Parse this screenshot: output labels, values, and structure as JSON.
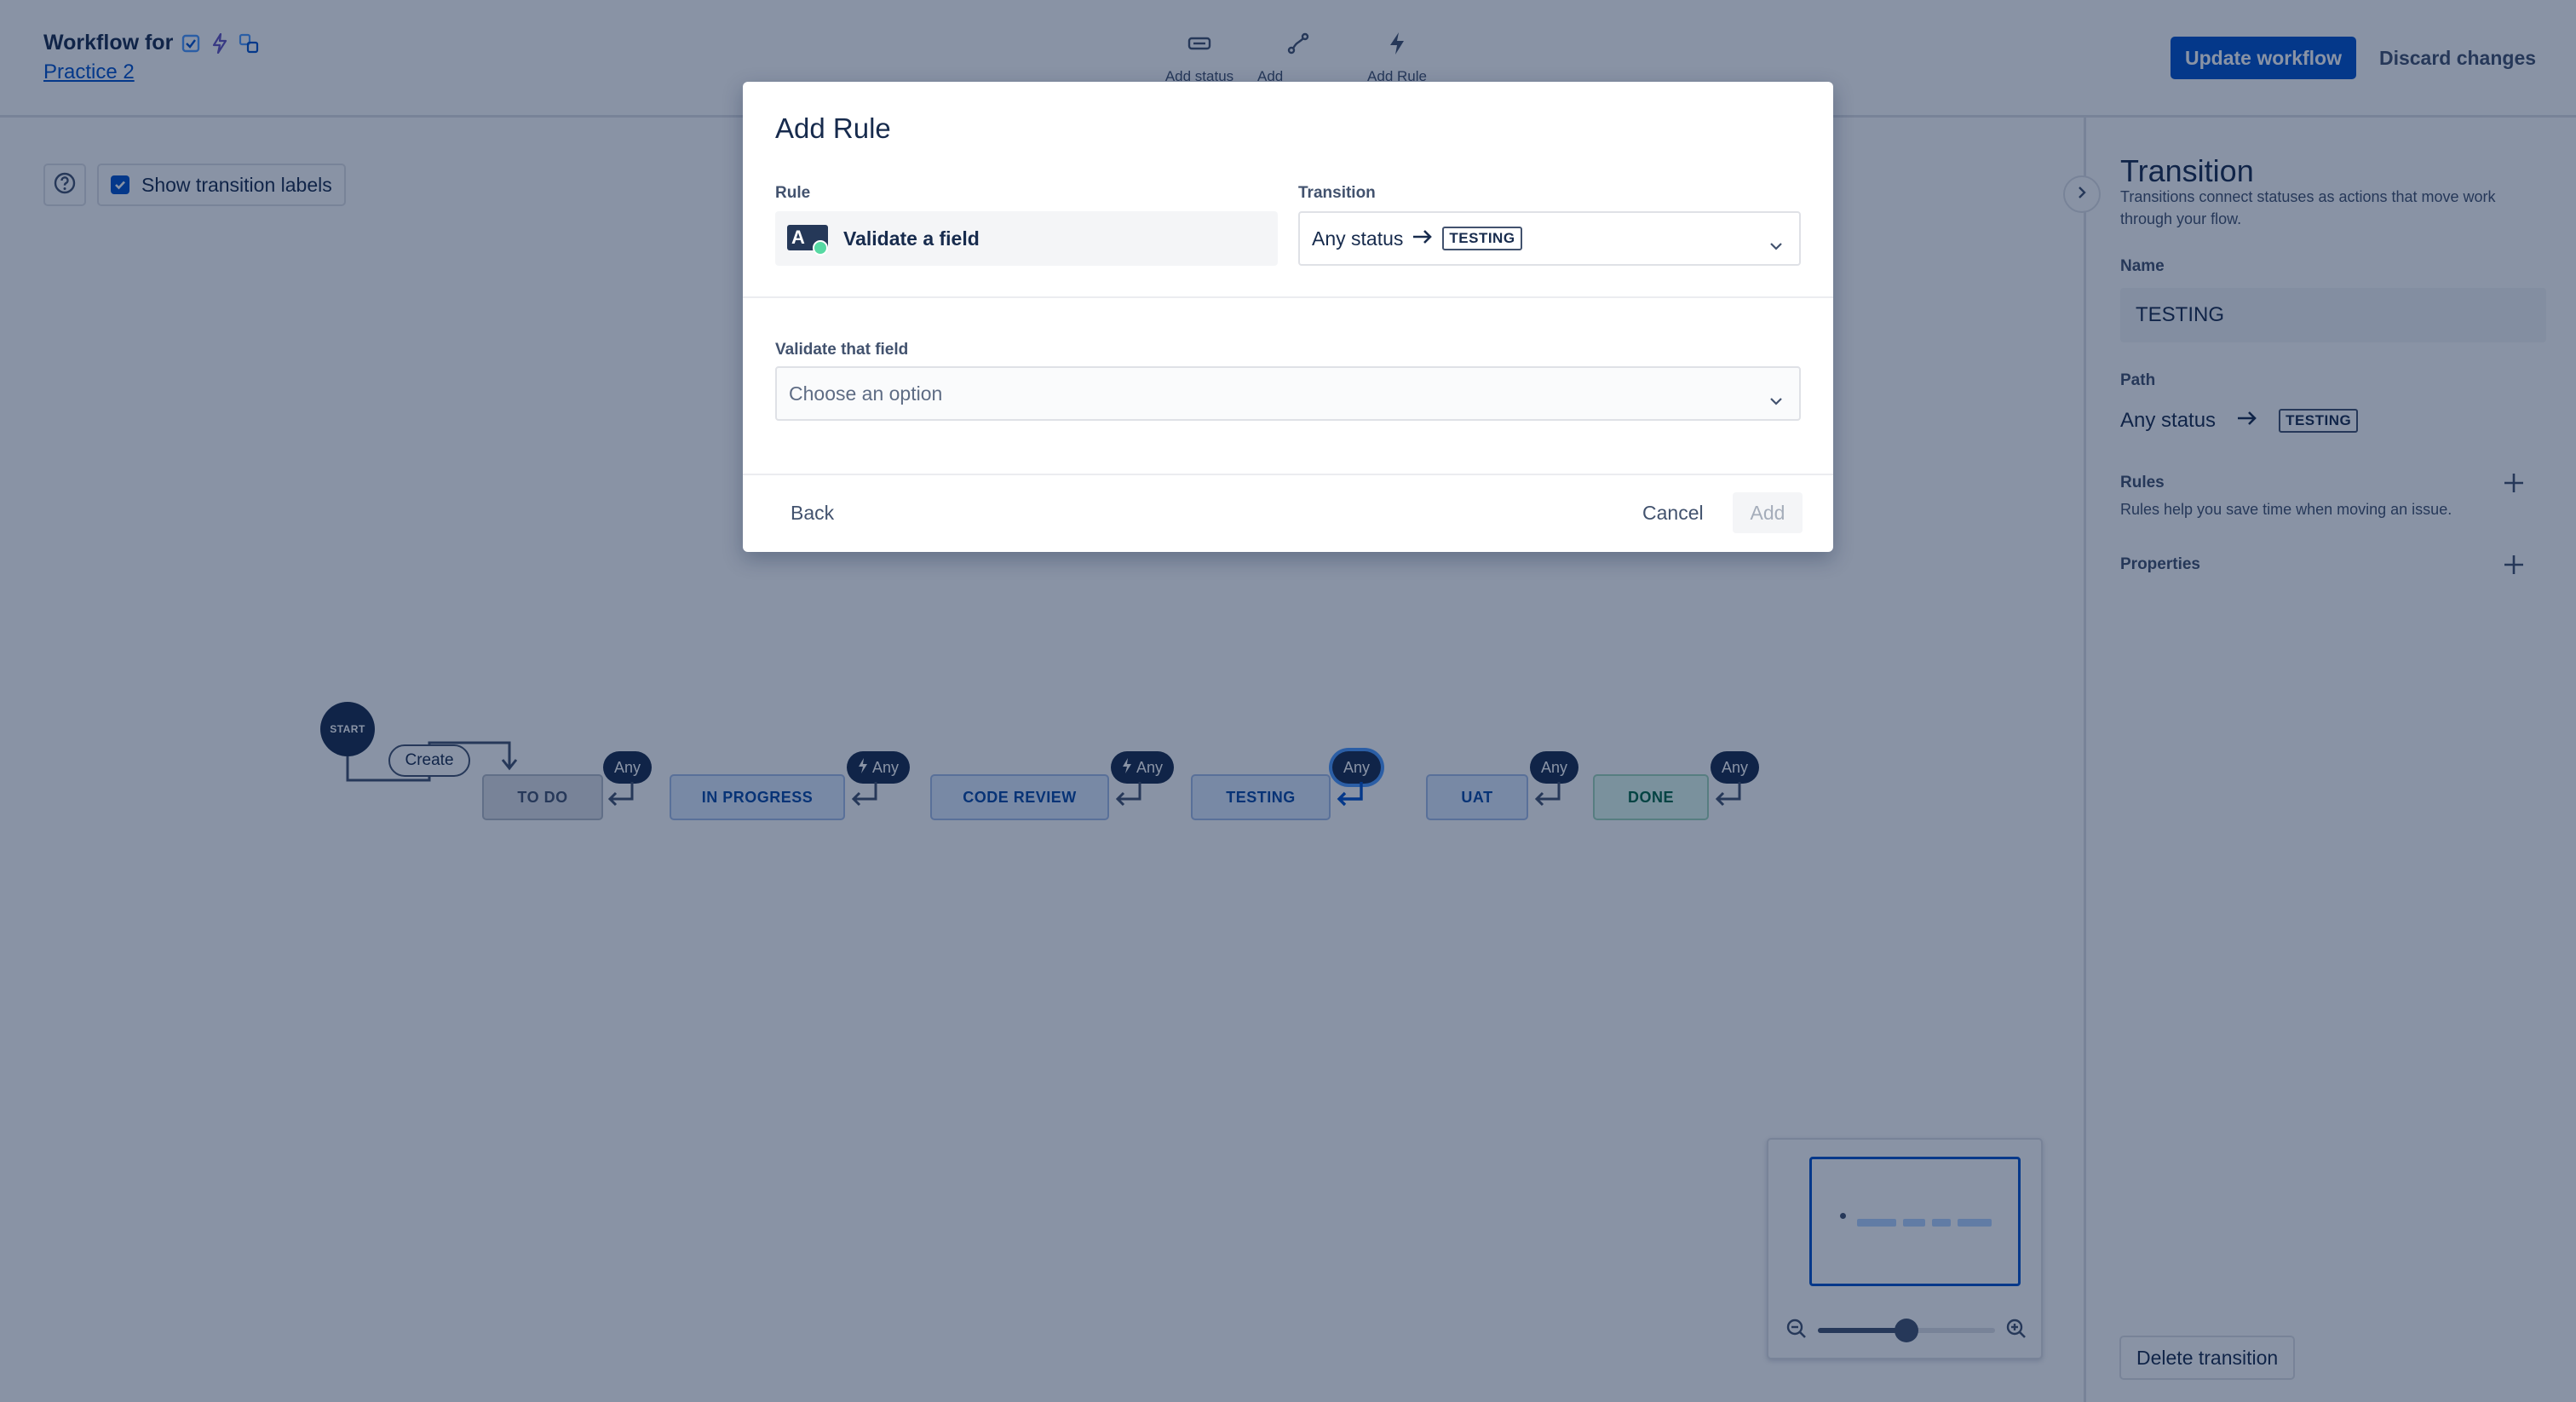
{
  "header": {
    "title_prefix": "Workflow for",
    "project_link": "Practice 2",
    "issue_type_icons": [
      "task-checkbox-icon",
      "epic-lightning-icon",
      "subtask-icon"
    ]
  },
  "toolbar": {
    "items": [
      {
        "label": "Add status",
        "icon": "status-rectangle-icon"
      },
      {
        "label": "Add Transition",
        "icon": "transition-path-icon"
      },
      {
        "label": "Add Rule",
        "icon": "lightning-icon"
      }
    ]
  },
  "actions": {
    "update": "Update workflow",
    "discard": "Discard changes"
  },
  "canvas": {
    "help_icon": "question-circle-icon",
    "show_labels": "Show transition labels",
    "show_labels_checked": true,
    "start": "START",
    "create": "Create",
    "any": "Any",
    "statuses": [
      "TO DO",
      "IN PROGRESS",
      "CODE REVIEW",
      "TESTING",
      "UAT",
      "DONE"
    ]
  },
  "panel": {
    "title": "Transition",
    "subtitle": "Transitions connect statuses as actions that move work through your flow.",
    "name_label": "Name",
    "name_value": "TESTING",
    "path_label": "Path",
    "path_from": "Any status",
    "path_to": "TESTING",
    "rules_label": "Rules",
    "rules_help": "Rules help you save time when moving an issue.",
    "properties_label": "Properties",
    "delete": "Delete transition"
  },
  "modal": {
    "title": "Add Rule",
    "rule_label": "Rule",
    "rule_value": "Validate a field",
    "rule_icon_letter": "A",
    "transition_label": "Transition",
    "transition_from": "Any status",
    "transition_to": "TESTING",
    "field_label": "Validate that field",
    "field_placeholder": "Choose an option",
    "back": "Back",
    "cancel": "Cancel",
    "add": "Add"
  },
  "zoom": {
    "level_fraction": 0.5
  },
  "colors": {
    "primary": "#0052cc",
    "overlay": "rgba(9,30,66,0.48)",
    "status_blue_bg": "#deebff",
    "status_green_bg": "#e3fcef",
    "selected_ring": "#4c9aff"
  }
}
